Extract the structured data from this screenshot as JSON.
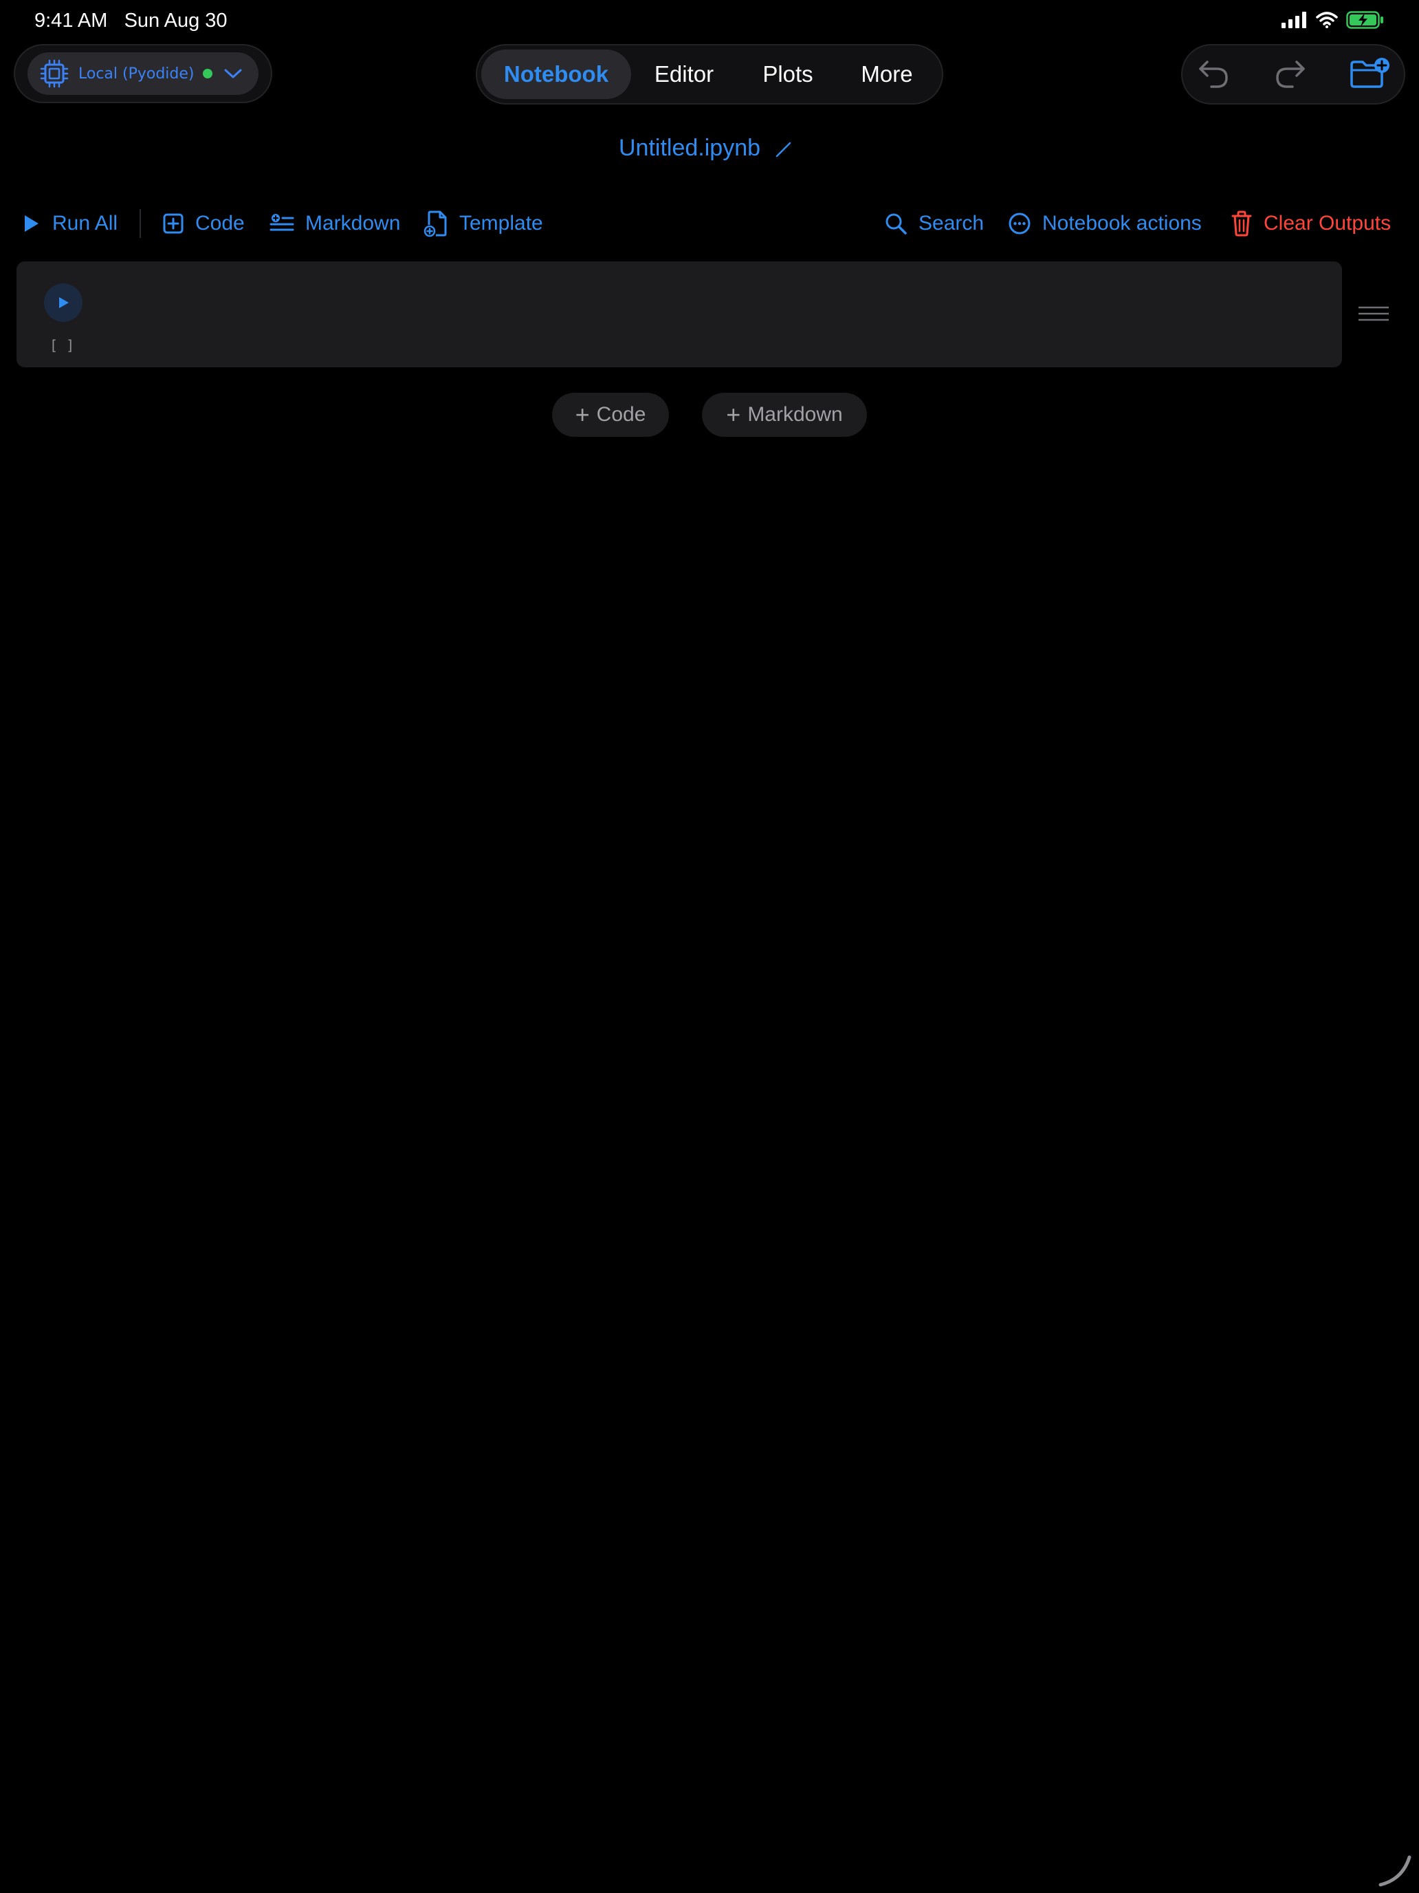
{
  "status_bar": {
    "time": "9:41 AM",
    "date": "Sun Aug 30"
  },
  "kernel": {
    "label": "Local (Pyodide)",
    "status_color": "#34c759",
    "icon": "cpu-icon"
  },
  "tabs": [
    {
      "label": "Notebook",
      "active": true
    },
    {
      "label": "Editor",
      "active": false
    },
    {
      "label": "Plots",
      "active": false
    },
    {
      "label": "More",
      "active": false
    }
  ],
  "actions": {
    "undo_icon": "undo-icon",
    "redo_icon": "redo-icon",
    "new_folder_icon": "folder-plus-icon"
  },
  "notebook": {
    "filename": "Untitled.ipynb"
  },
  "toolbar": {
    "run_all": "Run All",
    "code": "Code",
    "markdown": "Markdown",
    "template": "Template",
    "search": "Search",
    "notebook_actions": "Notebook actions",
    "clear_outputs": "Clear Outputs"
  },
  "cells": [
    {
      "type": "code",
      "source": "",
      "exec_count": "[ ]"
    }
  ],
  "add_cell": {
    "code": "Code",
    "markdown": "Markdown"
  },
  "colors": {
    "accent": "#2f8cf0",
    "danger": "#ff453a",
    "background": "#000000",
    "surface": "#1c1c1e"
  }
}
